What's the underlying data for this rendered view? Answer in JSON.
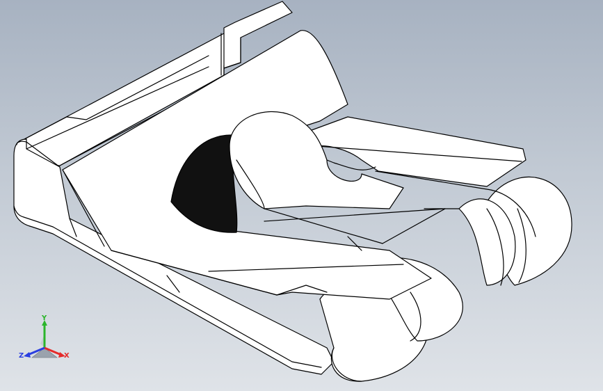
{
  "viewport": {
    "background_top": "#a7b2c1",
    "background_bottom": "#dfe3e8",
    "model_fill": "#ffffff",
    "model_edge": "#000000",
    "shadow_color": "#111111"
  },
  "triad": {
    "x_label": "X",
    "y_label": "Y",
    "z_label": "Z",
    "x_color": "#e52a2a",
    "y_color": "#2bb52b",
    "z_color": "#2a3ee0"
  }
}
